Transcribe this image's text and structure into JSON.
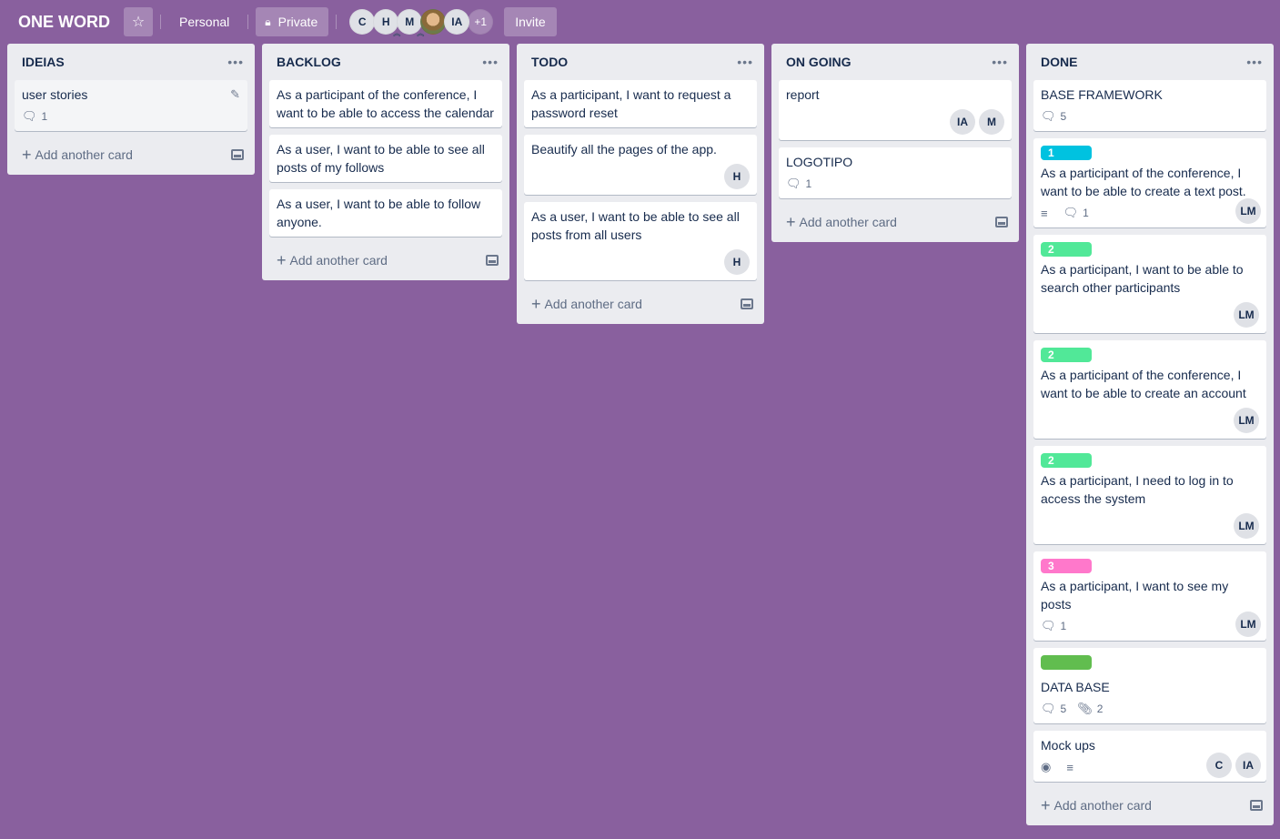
{
  "header": {
    "board_title": "ONE WORD",
    "star_icon": "☆",
    "workspace": "Personal",
    "lock_icon": "🔒",
    "visibility": "Private",
    "members": [
      {
        "initials": "C",
        "admin": false
      },
      {
        "initials": "H",
        "admin": true
      },
      {
        "initials": "M",
        "admin": true
      },
      {
        "initials": "",
        "photo": true
      },
      {
        "initials": "IA",
        "admin": false
      }
    ],
    "more_members": "+1",
    "invite": "Invite"
  },
  "colors": {
    "background": "#89609e",
    "label_blue": "#00c2e0",
    "label_green": "#51e898",
    "label_pink": "#ff78cb",
    "label_lime": "#61bd4f"
  },
  "add_card_label": "Add another card",
  "lists": [
    {
      "title": "IDEIAS",
      "cards": [
        {
          "title": "user stories",
          "comments": "1"
        }
      ]
    },
    {
      "title": "BACKLOG",
      "cards": [
        {
          "title": "As a participant of the conference, I want to be able to access the calendar"
        },
        {
          "title": "As a user, I want to be able to see all posts of my follows"
        },
        {
          "title": "As a user, I want to be able to follow anyone."
        }
      ]
    },
    {
      "title": "TODO",
      "cards": [
        {
          "title": "As a participant, I want to request a password reset"
        },
        {
          "title": "Beautify all the pages of the app.",
          "members": [
            "H"
          ]
        },
        {
          "title": "As a user, I want to be able to see all posts from all users",
          "members": [
            "H"
          ]
        }
      ]
    },
    {
      "title": "ON GOING",
      "cards": [
        {
          "title": "report",
          "members": [
            "IA",
            "M"
          ]
        },
        {
          "title": "LOGOTIPO",
          "comments": "1"
        }
      ]
    },
    {
      "title": "DONE",
      "cards": [
        {
          "title": "BASE FRAMEWORK",
          "comments": "5"
        },
        {
          "label": "1",
          "title": "As a participant of the conference, I want to be able to create a text post.",
          "comments": "1",
          "members": [
            "LM"
          ]
        },
        {
          "label": "2",
          "title": "As a participant, I want to be able to search other participants",
          "members": [
            "LM"
          ]
        },
        {
          "label": "2",
          "title": "As a participant of the conference, I want to be able to create an account",
          "members": [
            "LM"
          ]
        },
        {
          "label": "2",
          "title": "As a participant, I need to log in to access the system",
          "members": [
            "LM"
          ]
        },
        {
          "label": "3",
          "title": "As a participant, I want to see my posts",
          "comments": "1",
          "members": [
            "LM"
          ]
        },
        {
          "label": "",
          "title": "DATA BASE",
          "comments": "5",
          "attachments": "2"
        },
        {
          "title": "Mock ups",
          "members": [
            "C",
            "IA"
          ]
        }
      ]
    }
  ]
}
